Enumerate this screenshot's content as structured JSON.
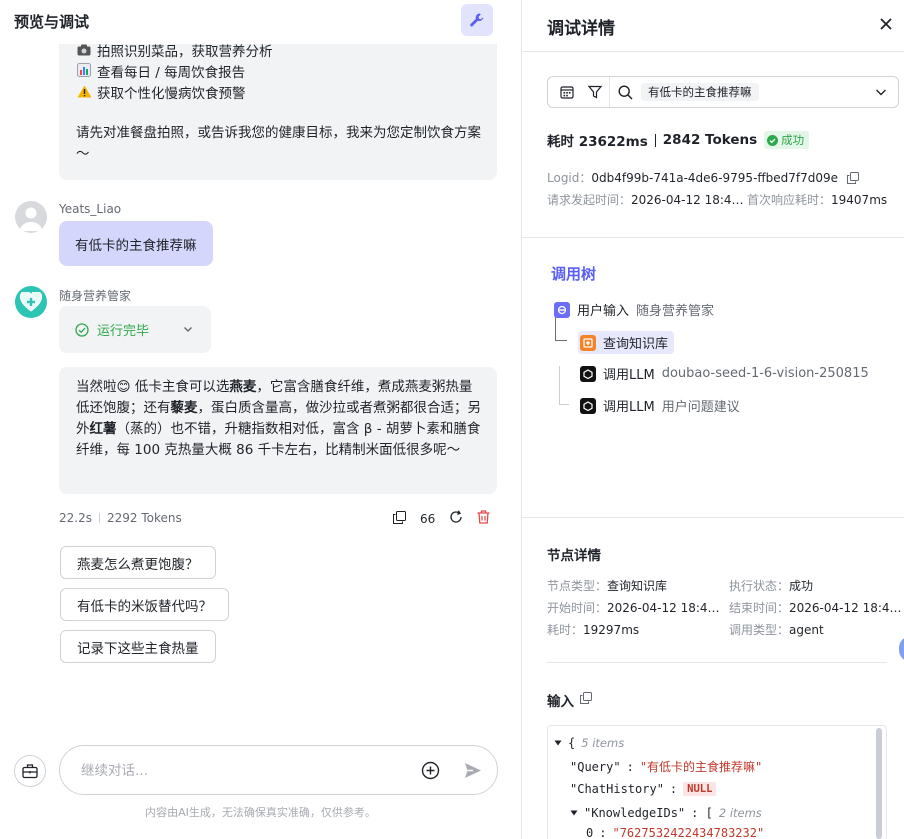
{
  "left": {
    "title": "预览与调试",
    "intro_lines": [
      {
        "icon": "camera-icon",
        "text": "拍照识别菜品，获取营养分析"
      },
      {
        "icon": "chart-icon",
        "text": "查看每日 / 每周饮食报告"
      },
      {
        "icon": "warning-icon",
        "text": "获取个性化慢病饮食预警"
      }
    ],
    "intro_paragraph": "请先对准餐盘拍照，或告诉我您的健康目标，我来为您定制饮食方案～",
    "user_name": "Yeats_Liao",
    "user_message": "有低卡的主食推荐嘛",
    "bot_name": "随身营养管家",
    "run_status": "运行完毕",
    "answer": {
      "p1": "当然啦",
      "emoji": "😊",
      "p2": " 低卡主食可以选",
      "b1": "燕麦",
      "p3": "，它富含膳食纤维，煮成燕麦粥热量低还饱腹；还有",
      "b2": "藜麦",
      "p4": "，蛋白质含量高，做沙拉或者煮粥都很合适；另外",
      "b3": "红薯",
      "p5": "（蒸的）也不错，升糖指数相对低，富含 β - 胡萝卜素和膳食纤维，每 100 克热量大概 86 千卡左右，比精制米面低很多呢～"
    },
    "duration": "22.2s",
    "tokens": "2292 Tokens",
    "quote_label": "66",
    "suggestions": [
      "燕麦怎么煮更饱腹？",
      "有低卡的米饭替代吗？",
      "记录下这些主食热量"
    ],
    "input_placeholder": "继续对话...",
    "disclaimer": "内容由AI生成，无法确保真实准确，仅供参考。"
  },
  "right": {
    "title": "调试详情",
    "search_tag": "有低卡的主食推荐嘛",
    "elapsed": "耗时 23622ms",
    "tokens": "2842 Tokens",
    "status": "成功",
    "logid_label": "Logid：",
    "logid": "0db4f99b-741a-4de6-9795-ffbed7f7d09e",
    "start_label": "请求发起时间：",
    "start_time": "2026-04-12 18:4…",
    "first_resp_label": "首次响应耗时：",
    "first_resp": "19407ms",
    "tree_title": "调用树",
    "tree": [
      {
        "label": "用户输入",
        "sub": "随身营养管家"
      },
      {
        "label": "查询知识库",
        "sub": ""
      },
      {
        "label": "调用LLM",
        "sub": "doubao-seed-1-6-vision-250815"
      },
      {
        "label": "调用LLM",
        "sub": "用户问题建议"
      }
    ],
    "node_title": "节点详情",
    "node": {
      "type_label": "节点类型：",
      "type": "查询知识库",
      "exec_label": "执行状态：",
      "exec": "成功",
      "start_label": "开始时间：",
      "start": "2026-04-12 18:4…",
      "end_label": "结束时间：",
      "end": "2026-04-12 18:4…",
      "cost_label": "耗时：",
      "cost": "19297ms",
      "call_label": "调用类型：",
      "call": "agent"
    },
    "input_title": "输入",
    "json": {
      "root_count": "5 items",
      "query_key": "\"Query\"",
      "query_val": "\"有低卡的主食推荐嘛\"",
      "history_key": "\"ChatHistory\"",
      "history_val": "NULL",
      "ids_key": "\"KnowledgeIDs\"",
      "ids_count": "2 items",
      "id0_key": "0",
      "id0_val": "\"7627532422434783232\""
    }
  },
  "colors": {
    "accent": "#5b5ff5",
    "success": "#2da84a",
    "user_bubble": "#d4d6fb",
    "danger": "#e5484d"
  }
}
